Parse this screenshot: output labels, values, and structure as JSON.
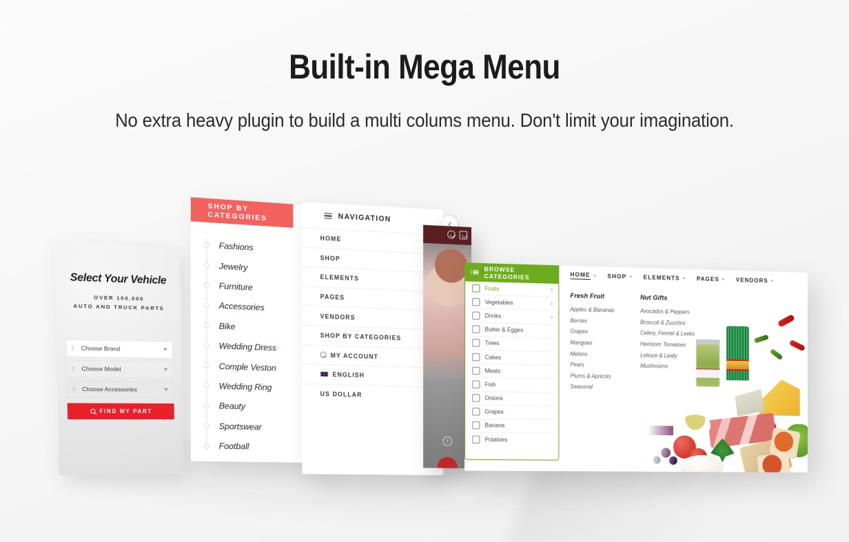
{
  "page": {
    "title": "Built-in Mega Menu",
    "subtitle": "No extra heavy plugin to build a multi colums menu. Don't limit your imagination."
  },
  "colors": {
    "background": "#f6f6f6",
    "coral": "#f4625e",
    "red_button": "#e8202a",
    "green": "#6dab1f",
    "text_dark": "#1c1c1c"
  },
  "vehicle_panel": {
    "title": "Select Your Vehicle",
    "subtitle_line1": "OVER 100.000",
    "subtitle_line2": "AUTO AND TRUCK PARTS",
    "selects": [
      {
        "number": "1",
        "label": "Choose Brand"
      },
      {
        "number": "2",
        "label": "Choose Model"
      },
      {
        "number": "3",
        "label": "Choose Accessories"
      }
    ],
    "button_label": "FIND MY PART"
  },
  "categories_panel": {
    "header": "SHOP BY CATEGORIES",
    "items": [
      {
        "label": "Fashions"
      },
      {
        "label": "Jewelry"
      },
      {
        "label": "Furniture"
      },
      {
        "label": "Accessories"
      },
      {
        "label": "Bike"
      },
      {
        "label": "Wedding Dress"
      },
      {
        "label": "Comple Veston"
      },
      {
        "label": "Wedding Ring"
      },
      {
        "label": "Beauty"
      },
      {
        "label": "Sportswear"
      },
      {
        "label": "Football"
      }
    ]
  },
  "navigation_panel": {
    "header": "NAVIGATION",
    "items": [
      {
        "label": "HOME",
        "icon": "",
        "expand": "+"
      },
      {
        "label": "SHOP",
        "icon": "",
        "expand": "+"
      },
      {
        "label": "ELEMENTS",
        "icon": "",
        "expand": "+"
      },
      {
        "label": "PAGES",
        "icon": "",
        "expand": "+"
      },
      {
        "label": "VENDORS",
        "icon": "",
        "expand": "+"
      },
      {
        "label": "SHOP BY CATEGORIES",
        "icon": "",
        "expand": "+"
      },
      {
        "label": "MY ACCOUNT",
        "icon": "user-icon",
        "expand": "+"
      },
      {
        "label": "ENGLISH",
        "icon": "uk-flag-icon",
        "expand": "+"
      },
      {
        "label": "US DOLLAR",
        "icon": "",
        "expand": "+"
      }
    ]
  },
  "mega_panel": {
    "browse_header": "BROWSE CATEGORIES",
    "browse_items": [
      {
        "label": "Fruits",
        "active": true,
        "has_arrow": true
      },
      {
        "label": "Vegetables",
        "active": false,
        "has_arrow": true
      },
      {
        "label": "Drinks",
        "active": false,
        "has_arrow": true
      },
      {
        "label": "Butter & Egges",
        "active": false,
        "has_arrow": false
      },
      {
        "label": "Trees",
        "active": false,
        "has_arrow": false
      },
      {
        "label": "Cakes",
        "active": false,
        "has_arrow": false
      },
      {
        "label": "Meats",
        "active": false,
        "has_arrow": false
      },
      {
        "label": "Fish",
        "active": false,
        "has_arrow": false
      },
      {
        "label": "Onions",
        "active": false,
        "has_arrow": false
      },
      {
        "label": "Grapes",
        "active": false,
        "has_arrow": false
      },
      {
        "label": "Banana",
        "active": false,
        "has_arrow": false
      },
      {
        "label": "Potatoes",
        "active": false,
        "has_arrow": false
      }
    ],
    "top_nav": [
      {
        "label": "HOME",
        "active": true
      },
      {
        "label": "SHOP",
        "active": false
      },
      {
        "label": "ELEMENTS",
        "active": false
      },
      {
        "label": "PAGES",
        "active": false
      },
      {
        "label": "VENDORS",
        "active": false
      }
    ],
    "columns": [
      {
        "title": "Fresh Fruit",
        "links": [
          "Apples & Bananas",
          "Berries",
          "Grapes",
          "Mangoes",
          "Melons",
          "Pears",
          "Plums & Apricots",
          "Seasonal"
        ]
      },
      {
        "title": "Nut Gifts",
        "links": [
          "Avocados & Peppers",
          "Broccoli & Zucchini",
          "Celery, Fennel & Leeks",
          "Heirloom Tomatoes",
          "Lettuce & Leafy",
          "Mushrooms"
        ]
      }
    ]
  }
}
